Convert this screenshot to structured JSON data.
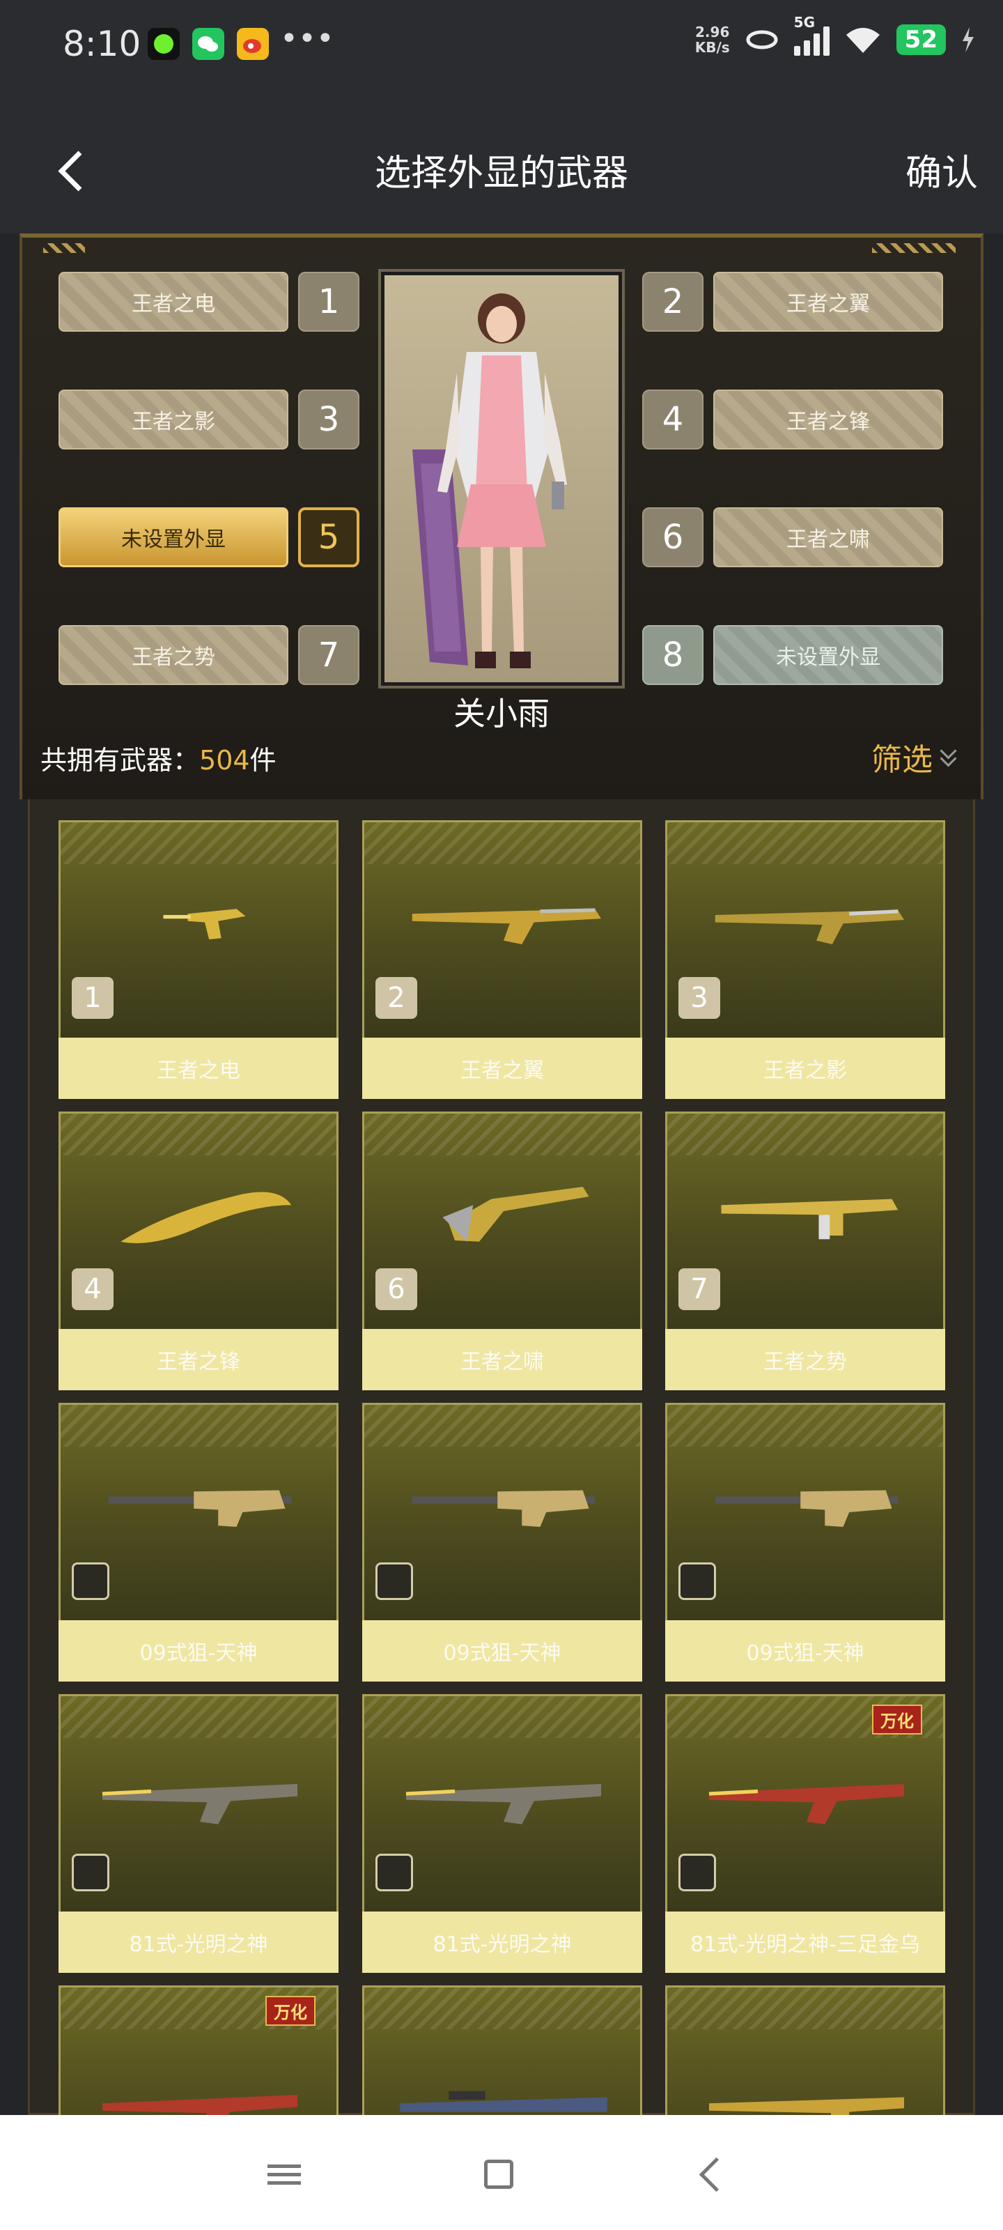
{
  "status_bar": {
    "time": "8:10",
    "net_speed_value": "2.96",
    "net_speed_unit": "KB/s",
    "network": "5G",
    "battery": "52"
  },
  "header": {
    "title": "选择外显的武器",
    "confirm": "确认"
  },
  "character": {
    "name": "关小雨"
  },
  "slots": [
    {
      "num": "1",
      "label": "王者之电"
    },
    {
      "num": "2",
      "label": "王者之翼"
    },
    {
      "num": "3",
      "label": "王者之影"
    },
    {
      "num": "4",
      "label": "王者之锋"
    },
    {
      "num": "5",
      "label": "未设置外显",
      "active": true
    },
    {
      "num": "6",
      "label": "王者之啸"
    },
    {
      "num": "7",
      "label": "王者之势"
    },
    {
      "num": "8",
      "label": "未设置外显"
    }
  ],
  "summary": {
    "prefix": "共拥有武器：",
    "count": "504",
    "suffix": "件",
    "filter": "筛选"
  },
  "weapons": [
    {
      "name": "王者之电",
      "badge": "1"
    },
    {
      "name": "王者之翼",
      "badge": "2"
    },
    {
      "name": "王者之影",
      "badge": "3"
    },
    {
      "name": "王者之锋",
      "badge": "4"
    },
    {
      "name": "王者之啸",
      "badge": "6"
    },
    {
      "name": "王者之势",
      "badge": "7"
    },
    {
      "name": "09式狙-天神"
    },
    {
      "name": "09式狙-天神"
    },
    {
      "name": "09式狙-天神"
    },
    {
      "name": "81式-光明之神"
    },
    {
      "name": "81式-光明之神"
    },
    {
      "name": "81式-光明之神-三足金乌",
      "tag": "万化"
    },
    {
      "name": "",
      "tag": "万化"
    },
    {
      "name": ""
    },
    {
      "name": ""
    }
  ],
  "colors": {
    "accent": "#e9b84a",
    "card_label_bg": "#efe6a2",
    "card_top": "#5a5822"
  }
}
